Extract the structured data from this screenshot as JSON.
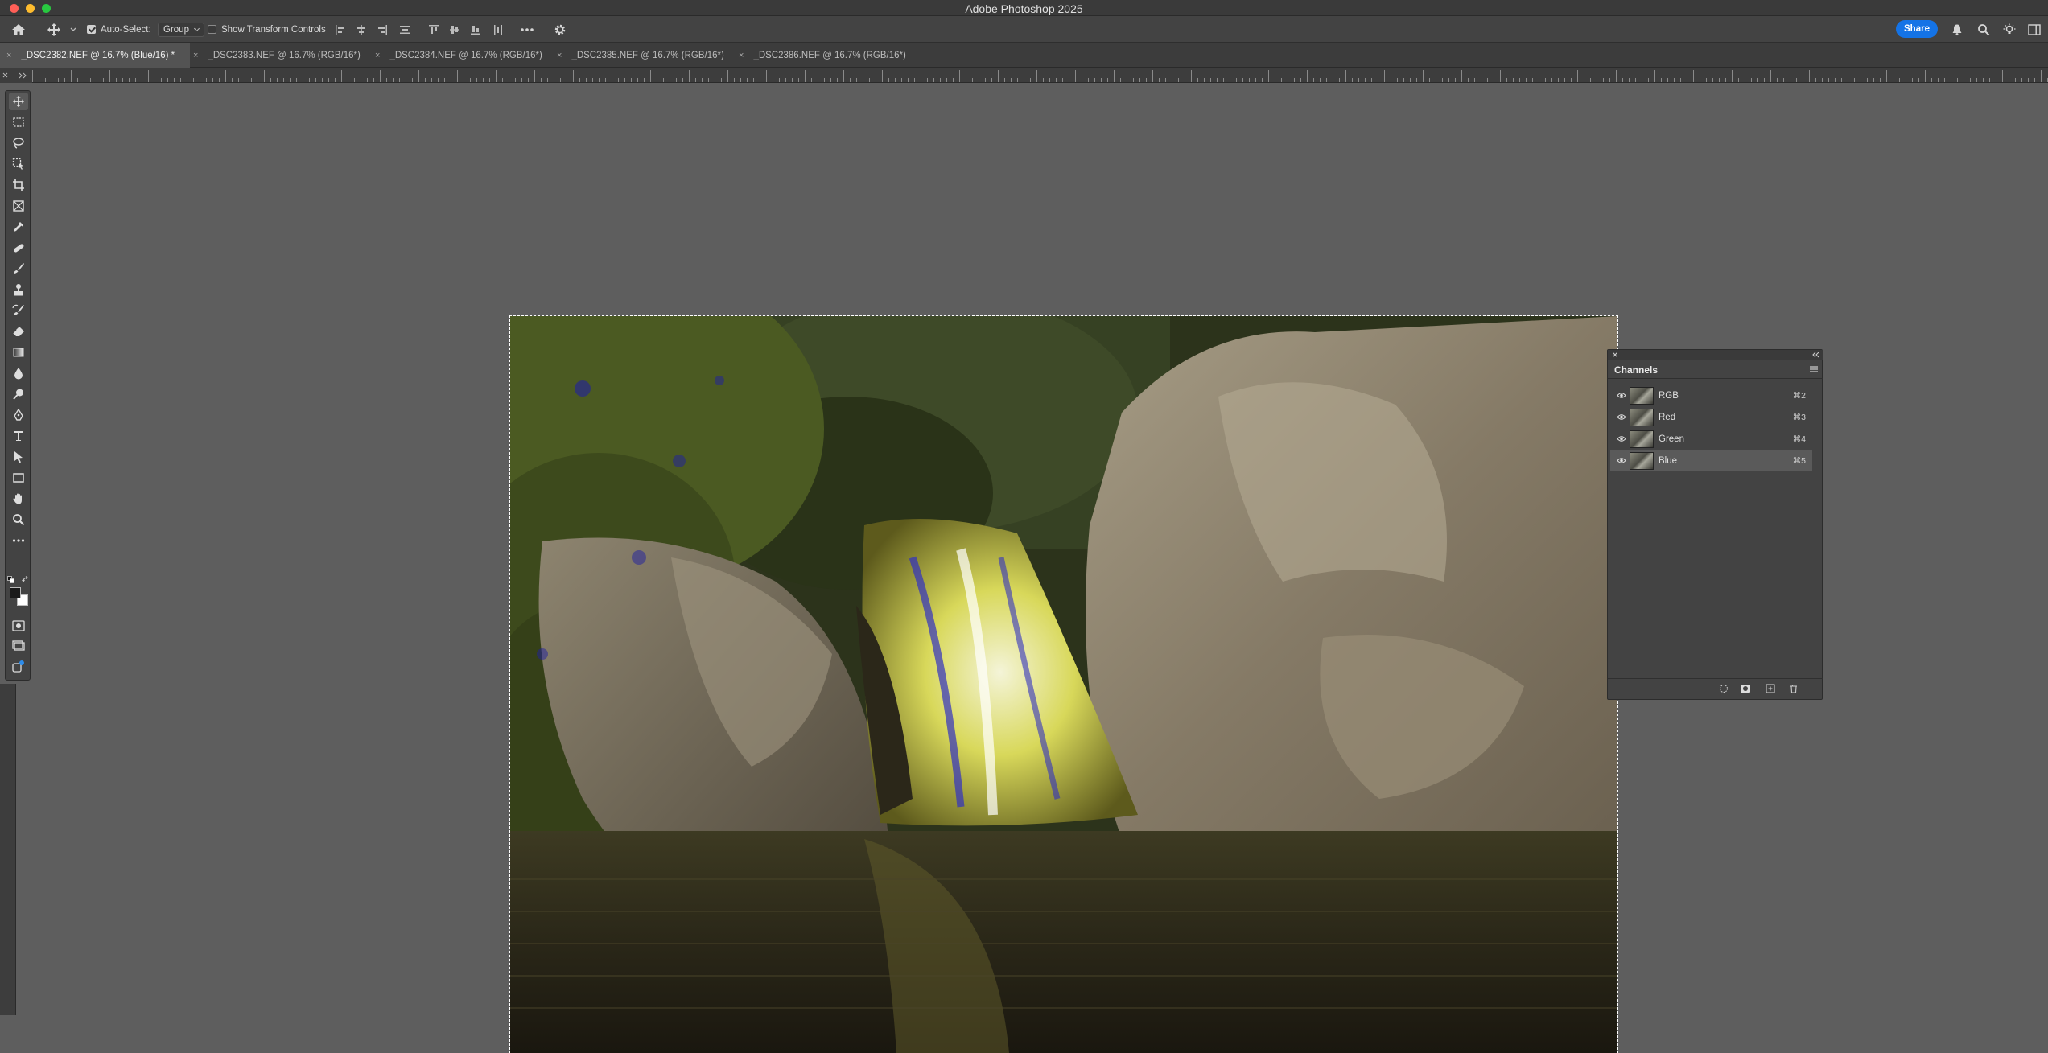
{
  "window": {
    "title": "Adobe Photoshop 2025"
  },
  "options_bar": {
    "auto_select_label": "Auto-Select:",
    "auto_select_checked": true,
    "auto_select_mode": "Group",
    "transform_controls_label": "Show Transform Controls",
    "transform_controls_checked": false,
    "share_label": "Share"
  },
  "tabs": [
    {
      "label": "_DSC2382.NEF @ 16.7% (Blue/16) *",
      "active": true
    },
    {
      "label": "_DSC2383.NEF @ 16.7% (RGB/16*)",
      "active": false
    },
    {
      "label": "_DSC2384.NEF @ 16.7% (RGB/16*)",
      "active": false
    },
    {
      "label": "_DSC2385.NEF @ 16.7% (RGB/16*)",
      "active": false
    },
    {
      "label": "_DSC2386.NEF @ 16.7% (RGB/16*)",
      "active": false
    }
  ],
  "tab_close_glyph": "×",
  "tools": [
    "move-tool-icon",
    "rectangular-marquee-icon",
    "lasso-icon",
    "object-selection-icon",
    "crop-icon",
    "frame-icon",
    "eyedropper-icon",
    "spot-healing-icon",
    "brush-icon",
    "clone-stamp-icon",
    "history-brush-icon",
    "eraser-icon",
    "gradient-icon",
    "blur-icon",
    "dodge-icon",
    "pen-icon",
    "type-icon",
    "path-selection-icon",
    "rectangle-icon",
    "hand-icon",
    "zoom-icon",
    "more-tools-icon"
  ],
  "colors": {
    "foreground": "#1a1a1a",
    "background": "#ffffff",
    "accent": "#1473e6"
  },
  "channels_panel": {
    "title": "Channels",
    "channels": [
      {
        "name": "RGB",
        "shortcut": "⌘2",
        "visible": true,
        "selected": false
      },
      {
        "name": "Red",
        "shortcut": "⌘3",
        "visible": true,
        "selected": false
      },
      {
        "name": "Green",
        "shortcut": "⌘4",
        "visible": true,
        "selected": false
      },
      {
        "name": "Blue",
        "shortcut": "⌘5",
        "visible": true,
        "selected": true
      }
    ]
  }
}
